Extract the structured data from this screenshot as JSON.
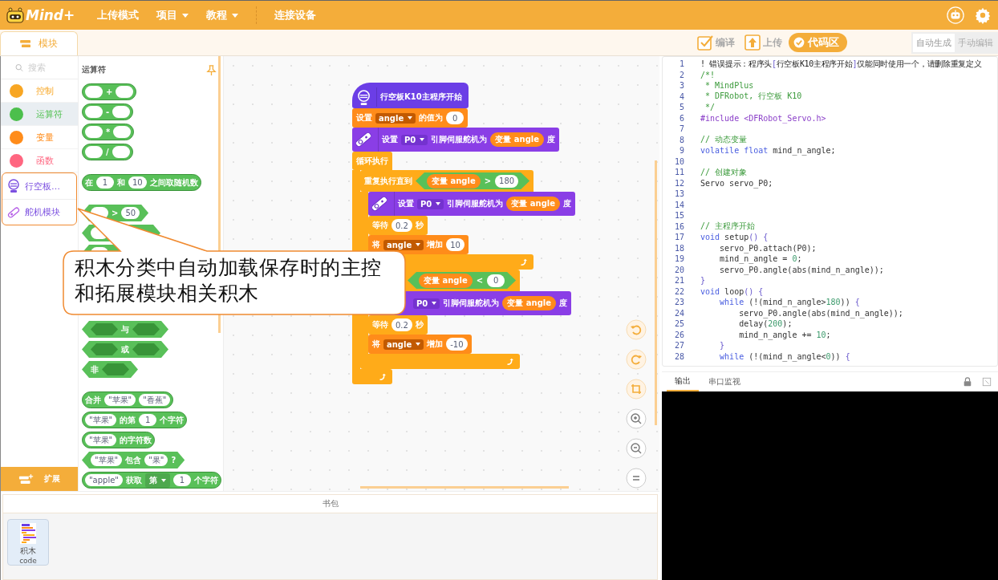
{
  "topbar": {
    "logo": "Mind+",
    "menus": [
      {
        "label": "上传模式",
        "dropdown": false
      },
      {
        "label": "项目",
        "dropdown": true
      },
      {
        "label": "教程",
        "dropdown": true
      },
      {
        "label": "连接设备",
        "dropdown": false
      }
    ]
  },
  "left_tab": {
    "label": "模块",
    "selected": true
  },
  "tools": [
    {
      "label": "编译",
      "kind": "compile",
      "selected": false
    },
    {
      "label": "上传",
      "kind": "upload",
      "selected": false
    },
    {
      "label": "代码区",
      "kind": "code",
      "selected": true
    }
  ],
  "code_modes": [
    {
      "label": "自动生成",
      "selected": true
    },
    {
      "label": "手动编辑",
      "selected": false
    }
  ],
  "search": {
    "placeholder": "搜索"
  },
  "categories": [
    {
      "label": "控制",
      "kind": "dot",
      "color": "#f8a623",
      "selected": false
    },
    {
      "label": "运算符",
      "kind": "dot",
      "color": "#4cbf4c",
      "selected": true
    },
    {
      "label": "变量",
      "kind": "dot",
      "color": "#ff8c1a",
      "selected": false
    },
    {
      "label": "函数",
      "kind": "dot",
      "color": "#ff6680",
      "selected": false
    }
  ],
  "extensions": [
    {
      "label": "行空板…",
      "kind": "board"
    },
    {
      "label": "舵机模块",
      "kind": "servo"
    }
  ],
  "extend_button": "扩展",
  "palette": {
    "title": "运算符",
    "blocks": [
      {
        "kind": "round",
        "parts": [
          {
            "kind": "slot"
          },
          {
            "kind": "label",
            "text": "+"
          },
          {
            "kind": "slot"
          }
        ]
      },
      {
        "kind": "round",
        "parts": [
          {
            "kind": "slot"
          },
          {
            "kind": "label",
            "text": "-"
          },
          {
            "kind": "slot"
          }
        ]
      },
      {
        "kind": "round",
        "parts": [
          {
            "kind": "slot"
          },
          {
            "kind": "label",
            "text": "*"
          },
          {
            "kind": "slot"
          }
        ]
      },
      {
        "kind": "round",
        "parts": [
          {
            "kind": "slot"
          },
          {
            "kind": "label",
            "text": "/"
          },
          {
            "kind": "slot"
          }
        ]
      },
      {
        "kind": "round",
        "parts": [
          {
            "kind": "label",
            "text": "在"
          },
          {
            "kind": "slot",
            "text": "1"
          },
          {
            "kind": "label",
            "text": "和"
          },
          {
            "kind": "slot",
            "text": "10"
          },
          {
            "kind": "label",
            "text": "之间取随机数"
          }
        ]
      },
      {
        "kind": "hex",
        "parts": [
          {
            "kind": "slot"
          },
          {
            "kind": "label",
            "text": ">"
          },
          {
            "kind": "slot",
            "text": "50"
          }
        ]
      },
      {
        "kind": "hex",
        "parts": [
          {
            "kind": "slot"
          },
          {
            "kind": "covered"
          }
        ]
      },
      {
        "kind": "hex",
        "parts": [
          {
            "kind": "slot"
          },
          {
            "kind": "covered"
          }
        ]
      },
      {
        "kind": "hex",
        "parts": [
          {
            "kind": "hexslot"
          },
          {
            "kind": "label",
            "text": "与"
          },
          {
            "kind": "hexslot"
          }
        ]
      },
      {
        "kind": "hex",
        "parts": [
          {
            "kind": "hexslot"
          },
          {
            "kind": "label",
            "text": "或"
          },
          {
            "kind": "hexslot"
          }
        ]
      },
      {
        "kind": "hex",
        "parts": [
          {
            "kind": "label",
            "text": "非"
          },
          {
            "kind": "hexslot"
          }
        ]
      },
      {
        "kind": "round",
        "parts": [
          {
            "kind": "label",
            "text": "合并"
          },
          {
            "kind": "slot",
            "text": "\"苹果\""
          },
          {
            "kind": "slot",
            "text": "\"香蕉\""
          }
        ]
      },
      {
        "kind": "round",
        "parts": [
          {
            "kind": "slot",
            "text": "\"苹果\""
          },
          {
            "kind": "label",
            "text": "的第"
          },
          {
            "kind": "slot",
            "text": "1"
          },
          {
            "kind": "label",
            "text": "个字符"
          }
        ]
      },
      {
        "kind": "round",
        "parts": [
          {
            "kind": "slot",
            "text": "\"苹果\""
          },
          {
            "kind": "label",
            "text": "的字符数"
          }
        ]
      },
      {
        "kind": "hex",
        "parts": [
          {
            "kind": "slot",
            "text": "\"苹果\""
          },
          {
            "kind": "label",
            "text": "包含"
          },
          {
            "kind": "slot",
            "text": "\"果\""
          },
          {
            "kind": "label",
            "text": "?"
          }
        ]
      },
      {
        "kind": "round",
        "parts": [
          {
            "kind": "slot",
            "text": "\"apple\""
          },
          {
            "kind": "label",
            "text": "获取"
          },
          {
            "kind": "dropdown",
            "text": "第"
          },
          {
            "kind": "slot",
            "text": "1"
          },
          {
            "kind": "label",
            "text": "个字符"
          }
        ]
      }
    ]
  },
  "script": {
    "hat": "行空板K10主程序开始",
    "blocks": [
      {
        "kind": "variable",
        "parts": [
          {
            "kind": "label",
            "text": "设置"
          },
          {
            "kind": "dropdown",
            "text": "angle"
          },
          {
            "kind": "label",
            "text": "的值为"
          },
          {
            "kind": "slot",
            "text": "0"
          }
        ]
      },
      {
        "kind": "servo",
        "parts": [
          {
            "kind": "label",
            "text": "设置"
          },
          {
            "kind": "dropdown",
            "text": "P0"
          },
          {
            "kind": "label",
            "text": "引脚伺服舵机为"
          },
          {
            "kind": "reporter",
            "text": "变量 angle"
          },
          {
            "kind": "label",
            "text": "度"
          }
        ]
      },
      {
        "kind": "loop",
        "parts": [
          {
            "kind": "label",
            "text": "循环执行"
          }
        ],
        "children": [
          {
            "kind": "loop",
            "parts": [
              {
                "kind": "label",
                "text": "重复执行直到"
              },
              {
                "kind": "cond",
                "parts": [
                  {
                    "kind": "reporter",
                    "text": "变量 angle"
                  },
                  {
                    "kind": "label",
                    "text": ">"
                  },
                  {
                    "kind": "slot",
                    "text": "180"
                  }
                ]
              }
            ],
            "children": [
              {
                "kind": "servo",
                "parts": [
                  {
                    "kind": "label",
                    "text": "设置"
                  },
                  {
                    "kind": "dropdown",
                    "text": "P0"
                  },
                  {
                    "kind": "label",
                    "text": "引脚伺服舵机为"
                  },
                  {
                    "kind": "reporter",
                    "text": "变量 angle"
                  },
                  {
                    "kind": "label",
                    "text": "度"
                  }
                ]
              },
              {
                "kind": "control",
                "parts": [
                  {
                    "kind": "label",
                    "text": "等待"
                  },
                  {
                    "kind": "slot",
                    "text": "0.2"
                  },
                  {
                    "kind": "label",
                    "text": "秒"
                  }
                ]
              },
              {
                "kind": "variable",
                "parts": [
                  {
                    "kind": "label",
                    "text": "将"
                  },
                  {
                    "kind": "dropdown",
                    "text": "angle"
                  },
                  {
                    "kind": "label",
                    "text": "增加"
                  },
                  {
                    "kind": "slot",
                    "text": "10"
                  }
                ]
              }
            ]
          },
          {
            "kind": "loop",
            "parts": [
              {
                "kind": "covered"
              },
              {
                "kind": "cond",
                "parts": [
                  {
                    "kind": "reporter",
                    "text": "变量 angle"
                  },
                  {
                    "kind": "label",
                    "text": "<"
                  },
                  {
                    "kind": "slot",
                    "text": "0"
                  }
                ]
              }
            ],
            "children": [
              {
                "kind": "servo",
                "parts": [
                  {
                    "kind": "covered"
                  },
                  {
                    "kind": "dropdown",
                    "text": "P0"
                  },
                  {
                    "kind": "label",
                    "text": "引脚伺服舵机为"
                  },
                  {
                    "kind": "reporter",
                    "text": "变量 angle"
                  },
                  {
                    "kind": "label",
                    "text": "度"
                  }
                ]
              },
              {
                "kind": "control",
                "parts": [
                  {
                    "kind": "label",
                    "text": "等待"
                  },
                  {
                    "kind": "slot",
                    "text": "0.2"
                  },
                  {
                    "kind": "label",
                    "text": "秒"
                  }
                ]
              },
              {
                "kind": "variable",
                "parts": [
                  {
                    "kind": "label",
                    "text": "将"
                  },
                  {
                    "kind": "dropdown",
                    "text": "angle"
                  },
                  {
                    "kind": "label",
                    "text": "增加"
                  },
                  {
                    "kind": "slot",
                    "text": "-10"
                  }
                ]
              }
            ]
          }
        ]
      }
    ]
  },
  "code": [
    {
      "n": "1",
      "s": [
        {
          "kind": "err",
          "text": "! 错误提示：程序头"
        },
        {
          "kind": "br",
          "text": "["
        },
        {
          "kind": "err",
          "text": "行空板K10主程序开始"
        },
        {
          "kind": "br",
          "text": "]"
        },
        {
          "kind": "err",
          "text": "仅能同时使用一个，请删除重复定义"
        }
      ]
    },
    {
      "n": "2",
      "s": [
        {
          "kind": "cm",
          "text": "/*!"
        }
      ]
    },
    {
      "n": "3",
      "s": [
        {
          "kind": "cm",
          "text": " * MindPlus"
        }
      ]
    },
    {
      "n": "4",
      "s": [
        {
          "kind": "cm",
          "text": " * DFRobot, 行空板 K10"
        }
      ]
    },
    {
      "n": "5",
      "s": [
        {
          "kind": "cm",
          "text": " */"
        }
      ]
    },
    {
      "n": "6",
      "s": [
        {
          "kind": "pp",
          "text": "#include "
        },
        {
          "kind": "str",
          "text": "<DFRobot_Servo.h>"
        }
      ]
    },
    {
      "n": "7"
    },
    {
      "n": "8",
      "s": [
        {
          "kind": "cm",
          "text": "// 动态变量"
        }
      ]
    },
    {
      "n": "9",
      "s": [
        {
          "kind": "kw",
          "text": "volatile float "
        },
        {
          "kind": "pl",
          "text": "mind_n_angle;"
        }
      ]
    },
    {
      "n": "10"
    },
    {
      "n": "11",
      "s": [
        {
          "kind": "cm",
          "text": "// 创建对象"
        }
      ]
    },
    {
      "n": "12",
      "s": [
        {
          "kind": "pl",
          "text": "Servo servo_P0;"
        }
      ]
    },
    {
      "n": "13"
    },
    {
      "n": "14"
    },
    {
      "n": "15"
    },
    {
      "n": "16",
      "s": [
        {
          "kind": "cm",
          "text": "// 主程序开始"
        }
      ]
    },
    {
      "n": "17",
      "s": [
        {
          "kind": "kw",
          "text": "void "
        },
        {
          "kind": "pl",
          "text": "setup"
        },
        {
          "kind": "br",
          "text": "() {"
        }
      ]
    },
    {
      "n": "18",
      "s": [
        {
          "kind": "pl",
          "text": "    servo_P0.attach(P0);"
        }
      ]
    },
    {
      "n": "19",
      "s": [
        {
          "kind": "pl",
          "text": "    mind_n_angle = "
        },
        {
          "kind": "num",
          "text": "0"
        },
        {
          "kind": "pl",
          "text": ";"
        }
      ]
    },
    {
      "n": "20",
      "s": [
        {
          "kind": "pl",
          "text": "    servo_P0.angle(abs(mind_n_angle));"
        }
      ]
    },
    {
      "n": "21",
      "s": [
        {
          "kind": "br",
          "text": "}"
        }
      ]
    },
    {
      "n": "22",
      "s": [
        {
          "kind": "kw",
          "text": "void "
        },
        {
          "kind": "pl",
          "text": "loop"
        },
        {
          "kind": "br",
          "text": "() {"
        }
      ]
    },
    {
      "n": "23",
      "s": [
        {
          "kind": "kw",
          "text": "    while "
        },
        {
          "kind": "pl",
          "text": "(!(mind_n_angle>"
        },
        {
          "kind": "num",
          "text": "180"
        },
        {
          "kind": "pl",
          "text": ")) "
        },
        {
          "kind": "br",
          "text": "{"
        }
      ]
    },
    {
      "n": "24",
      "s": [
        {
          "kind": "pl",
          "text": "        servo_P0.angle(abs(mind_n_angle));"
        }
      ]
    },
    {
      "n": "25",
      "s": [
        {
          "kind": "pl",
          "text": "        delay("
        },
        {
          "kind": "num",
          "text": "200"
        },
        {
          "kind": "pl",
          "text": ");"
        }
      ]
    },
    {
      "n": "26",
      "s": [
        {
          "kind": "pl",
          "text": "        mind_n_angle += "
        },
        {
          "kind": "num",
          "text": "10"
        },
        {
          "kind": "pl",
          "text": ";"
        }
      ]
    },
    {
      "n": "27",
      "s": [
        {
          "kind": "br",
          "text": "    }"
        }
      ]
    },
    {
      "n": "28",
      "s": [
        {
          "kind": "kw",
          "text": "    while "
        },
        {
          "kind": "pl",
          "text": "(!(mind_n_angle<"
        },
        {
          "kind": "num",
          "text": "0"
        },
        {
          "kind": "pl",
          "text": ")) "
        },
        {
          "kind": "br",
          "text": "{"
        }
      ]
    }
  ],
  "output_tabs": [
    {
      "label": "输出",
      "selected": true
    },
    {
      "label": "串口监视",
      "selected": false
    }
  ],
  "backpack": {
    "title": "书包",
    "items": [
      {
        "label": "积木",
        "sublabel": "code"
      }
    ]
  },
  "callout": "积木分类中自动加载保存时的主控和拓展模块相关积木"
}
